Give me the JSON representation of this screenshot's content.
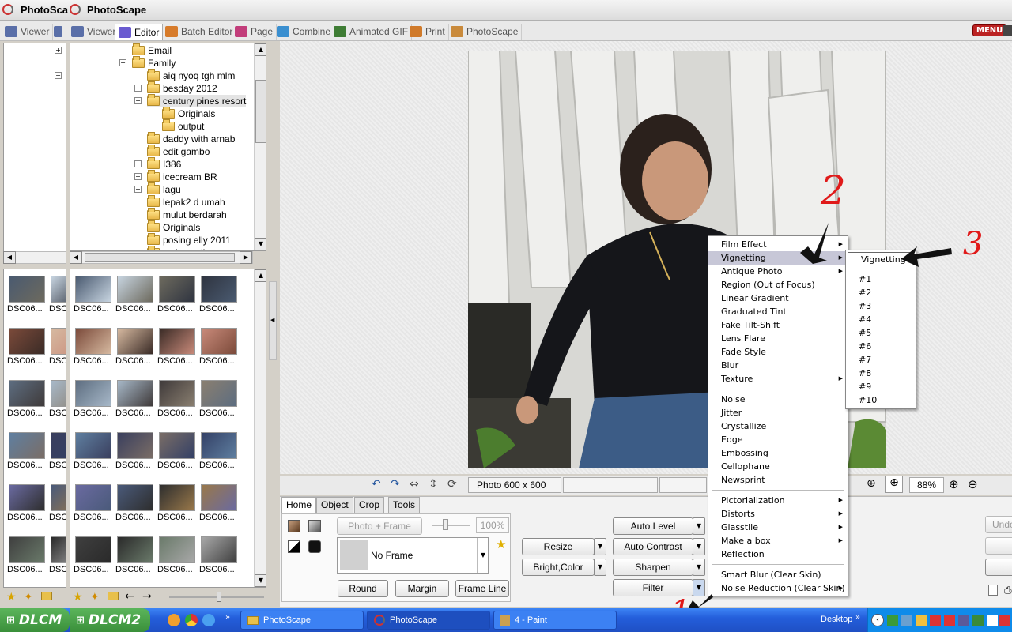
{
  "window": {
    "title_left": "PhotoSca",
    "title": "PhotoScape"
  },
  "tabs": [
    {
      "label": "Viewer",
      "color": "#5a6fa8"
    },
    {
      "label": "Viewer",
      "color": "#5a6fa8"
    },
    {
      "label": "Editor",
      "color": "#6a5bd0"
    },
    {
      "label": "Batch Editor",
      "color": "#d77b2a"
    },
    {
      "label": "Page",
      "color": "#c23d7a"
    },
    {
      "label": "Combine",
      "color": "#3a8fd0"
    },
    {
      "label": "Animated GIF",
      "color": "#3e7c34"
    },
    {
      "label": "Print",
      "color": "#d07a2a"
    },
    {
      "label": "PhotoScape",
      "color": "#c98a3b"
    }
  ],
  "menu_label": "MENU",
  "folder_tree": [
    {
      "label": "Email",
      "depth": 1,
      "toggle": ""
    },
    {
      "label": "Family",
      "depth": 1,
      "toggle": "-"
    },
    {
      "label": "aiq nyoq tgh mlm",
      "depth": 2,
      "toggle": ""
    },
    {
      "label": "besday 2012",
      "depth": 2,
      "toggle": "+"
    },
    {
      "label": "century pines resort",
      "depth": 2,
      "toggle": "-"
    },
    {
      "label": "Originals",
      "depth": 3,
      "toggle": ""
    },
    {
      "label": "output",
      "depth": 3,
      "toggle": ""
    },
    {
      "label": "daddy with arnab",
      "depth": 2,
      "toggle": ""
    },
    {
      "label": "edit gambo",
      "depth": 2,
      "toggle": ""
    },
    {
      "label": "I386",
      "depth": 2,
      "toggle": "+"
    },
    {
      "label": "icecream BR",
      "depth": 2,
      "toggle": "+"
    },
    {
      "label": "lagu",
      "depth": 2,
      "toggle": "+"
    },
    {
      "label": "lepak2 d umah",
      "depth": 2,
      "toggle": ""
    },
    {
      "label": "mulut berdarah",
      "depth": 2,
      "toggle": ""
    },
    {
      "label": "Originals",
      "depth": 2,
      "toggle": ""
    },
    {
      "label": "posing elly 2011",
      "depth": 2,
      "toggle": ""
    },
    {
      "label": "xxdesmall",
      "depth": 2,
      "toggle": ""
    }
  ],
  "thumb_caption": "DSC06...",
  "thumb_caption_cut": "DSC",
  "thumb_colors": [
    [
      "#4a5a70",
      "#c7d4e0",
      "#6d6a5e",
      "#2f3440"
    ],
    [
      "#7b4a3a",
      "#d6b9a0",
      "#3a2b26",
      "#c98a7a"
    ],
    [
      "#5d6d80",
      "#a7b8c8",
      "#3f3a3a",
      "#8a7f70"
    ],
    [
      "#5f7fa0",
      "#3a3f5e",
      "#7a6d66",
      "#334066"
    ],
    [
      "#6a6aa0",
      "#4a5a7a",
      "#2e2e2e",
      "#99784a"
    ],
    [
      "#3f3f3f",
      "#2a2a2a",
      "#6a7a6a",
      "#a8a8a8"
    ]
  ],
  "photo": {
    "size_label": "Photo 600 x 600"
  },
  "zoom": "88%",
  "editor_tabs": [
    "Home",
    "Object",
    "Crop",
    "Tools"
  ],
  "home": {
    "photo_frame": "Photo + Frame",
    "opacity": "100%",
    "frame_value": "No Frame",
    "round": "Round",
    "margin": "Margin",
    "frame_line": "Frame Line",
    "resize": "Resize",
    "bright_color": "Bright,Color",
    "auto_level": "Auto Level",
    "auto_contrast": "Auto Contrast",
    "sharpen": "Sharpen",
    "filter": "Filter",
    "undo": "Undo"
  },
  "filter_menu": [
    {
      "label": "Film Effect",
      "sub": true
    },
    {
      "label": "Vignetting",
      "sub": true,
      "selected": true
    },
    {
      "label": "Antique Photo",
      "sub": true
    },
    {
      "label": "Region (Out of Focus)",
      "sub": false
    },
    {
      "label": "Linear Gradient",
      "sub": false
    },
    {
      "label": "Graduated Tint",
      "sub": false
    },
    {
      "label": "Fake Tilt-Shift",
      "sub": false
    },
    {
      "label": "Lens Flare",
      "sub": false
    },
    {
      "label": "Fade Style",
      "sub": false
    },
    {
      "label": "Blur",
      "sub": false
    },
    {
      "label": "Texture",
      "sub": true
    },
    {
      "sep": true
    },
    {
      "label": "Noise",
      "sub": false
    },
    {
      "label": "Jitter",
      "sub": false
    },
    {
      "label": "Crystallize",
      "sub": false
    },
    {
      "label": "Edge",
      "sub": false
    },
    {
      "label": "Embossing",
      "sub": false
    },
    {
      "label": "Cellophane",
      "sub": false
    },
    {
      "label": "Newsprint",
      "sub": false
    },
    {
      "sep": true
    },
    {
      "label": "Pictorialization",
      "sub": true
    },
    {
      "label": "Distorts",
      "sub": true
    },
    {
      "label": "Glasstile",
      "sub": true
    },
    {
      "label": "Make a box",
      "sub": true
    },
    {
      "label": "Reflection",
      "sub": false
    },
    {
      "sep": true
    },
    {
      "label": "Smart Blur (Clear Skin)",
      "sub": false
    },
    {
      "label": "Noise Reduction (Clear Skin)",
      "sub": true
    }
  ],
  "vignetting_menu": [
    "Vignetting",
    "#1",
    "#2",
    "#3",
    "#4",
    "#5",
    "#6",
    "#7",
    "#8",
    "#9",
    "#10"
  ],
  "annotations": [
    "1",
    "2",
    "3"
  ],
  "taskbar": {
    "start1": "DLCM",
    "start2": "DLCM2",
    "tasks": [
      "PhotoScape",
      "PhotoScape",
      "4 - Paint"
    ],
    "desktop": "Desktop"
  }
}
